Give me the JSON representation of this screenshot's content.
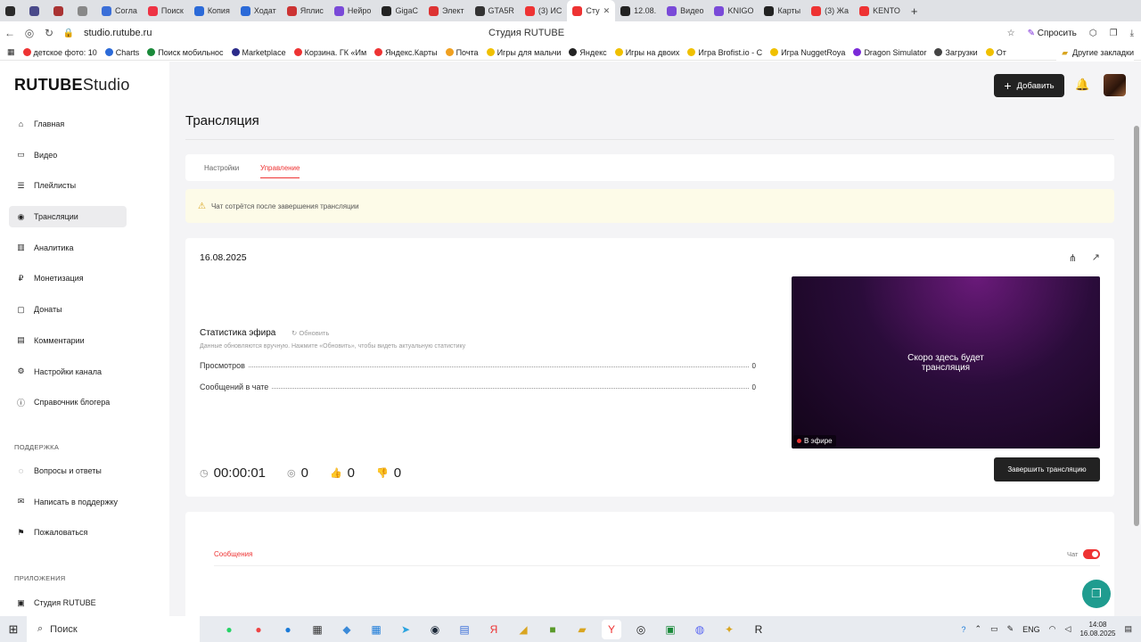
{
  "browser": {
    "tabs": [
      {
        "label": "",
        "color": "#2b2b2b"
      },
      {
        "label": "",
        "color": "#4a4a8a"
      },
      {
        "label": "",
        "color": "#aa3333"
      },
      {
        "label": "",
        "color": "#888"
      },
      {
        "label": "Согла",
        "color": "#3b6fd8"
      },
      {
        "label": "Поиск",
        "color": "#e34"
      },
      {
        "label": "Копия",
        "color": "#2b6ad8"
      },
      {
        "label": "Ходат",
        "color": "#2b6ad8"
      },
      {
        "label": "Яплис",
        "color": "#c33"
      },
      {
        "label": "Нейро",
        "color": "#7a4ad8"
      },
      {
        "label": "GigaC",
        "color": "#222"
      },
      {
        "label": "Элект",
        "color": "#d33"
      },
      {
        "label": "GTA5R",
        "color": "#333"
      },
      {
        "label": "(3) ИС",
        "color": "#e33"
      },
      {
        "label": "Сту",
        "color": "#e33",
        "active": true
      },
      {
        "label": "12.08.",
        "color": "#222"
      },
      {
        "label": "Видео",
        "color": "#7a4ad8"
      },
      {
        "label": "KNIGO",
        "color": "#7a4ad8"
      },
      {
        "label": "Карты",
        "color": "#222"
      },
      {
        "label": "(3) Жа",
        "color": "#e33"
      },
      {
        "label": "KENTO",
        "color": "#e33"
      }
    ],
    "url": "studio.rutube.ru",
    "page_title": "Студия RUTUBE",
    "ask_label": "Спросить",
    "bookmarks": [
      {
        "label": "детское фото: 10",
        "color": "#e33"
      },
      {
        "label": "Charts",
        "color": "#2b6ad8"
      },
      {
        "label": "Поиск мобильнос",
        "color": "#1a8a3a"
      },
      {
        "label": "Marketplace",
        "color": "#2b2b8a"
      },
      {
        "label": "Корзина. ГК «Им",
        "color": "#e33"
      },
      {
        "label": "Яндекс.Карты",
        "color": "#e33"
      },
      {
        "label": "Почта",
        "color": "#f0a020"
      },
      {
        "label": "Игры для мальчи",
        "color": "#f0c000"
      },
      {
        "label": "Яндекс",
        "color": "#222"
      },
      {
        "label": "Игры на двоих",
        "color": "#f0c000"
      },
      {
        "label": "Игра Brofist.io - С",
        "color": "#f0c000"
      },
      {
        "label": "Игра NuggetRoya",
        "color": "#f0c000"
      },
      {
        "label": "Dragon Simulator",
        "color": "#7a2ad8"
      },
      {
        "label": "Загрузки",
        "color": "#444"
      },
      {
        "label": "От",
        "color": "#f0c000"
      }
    ],
    "other_bookmarks": "Другие закладки"
  },
  "logo": {
    "brand": "RUTUBE",
    "suffix": "Studio"
  },
  "sidebar": {
    "items": [
      {
        "label": "Главная",
        "icon": "home-icon",
        "glyph": "⌂"
      },
      {
        "label": "Видео",
        "icon": "video-icon",
        "glyph": "▭"
      },
      {
        "label": "Плейлисты",
        "icon": "playlist-icon",
        "glyph": "☰"
      },
      {
        "label": "Трансляции",
        "icon": "broadcast-icon",
        "glyph": "◉",
        "active": true
      },
      {
        "label": "Аналитика",
        "icon": "analytics-icon",
        "glyph": "▥"
      },
      {
        "label": "Монетизация",
        "icon": "money-icon",
        "glyph": "₽"
      },
      {
        "label": "Донаты",
        "icon": "donate-icon",
        "glyph": "▢"
      },
      {
        "label": "Комментарии",
        "icon": "comment-icon",
        "glyph": "▤"
      },
      {
        "label": "Настройки канала",
        "icon": "settings-icon",
        "glyph": "⚙"
      },
      {
        "label": "Справочник блогера",
        "icon": "help-book-icon",
        "glyph": "ⓘ"
      }
    ],
    "support_title": "ПОДДЕРЖКА",
    "support_items": [
      {
        "label": "Вопросы и ответы",
        "icon": "faq-icon",
        "glyph": "◌"
      },
      {
        "label": "Написать в поддержку",
        "icon": "mail-icon",
        "glyph": "✉"
      },
      {
        "label": "Пожаловаться",
        "icon": "flag-icon",
        "glyph": "⚑"
      }
    ],
    "apps_title": "ПРИЛОЖЕНИЯ",
    "apps_items": [
      {
        "label": "Студия RUTUBE",
        "icon": "studio-app-icon",
        "glyph": "▣"
      }
    ]
  },
  "topbar": {
    "add_label": "Добавить"
  },
  "page": {
    "title": "Трансляция",
    "tabs": [
      "Настройки",
      "Управление"
    ],
    "warning": "Чат сотрётся после завершения трансляции",
    "date": "16.08.2025",
    "stats_title": "Статистика эфира",
    "refresh_label": "Обновить",
    "stats_note": "Данные обновляются вручную. Нажмите «Обновить», чтобы видеть актуальную статистику",
    "stats": [
      {
        "label": "Просмотров",
        "value": "0"
      },
      {
        "label": "Сообщений в чате",
        "value": "0"
      }
    ],
    "player_message": "Скоро здесь будет трансляция",
    "live_label": "В эфире",
    "duration": "00:00:01",
    "viewers": "0",
    "likes": "0",
    "dislikes": "0",
    "end_button": "Завершить трансляцию",
    "chat_tab": "Сообщения",
    "chat_toggle_label": "Чат"
  },
  "taskbar": {
    "search_label": "Поиск",
    "lang": "ENG",
    "time": "14:08",
    "date": "16.08.2025"
  }
}
